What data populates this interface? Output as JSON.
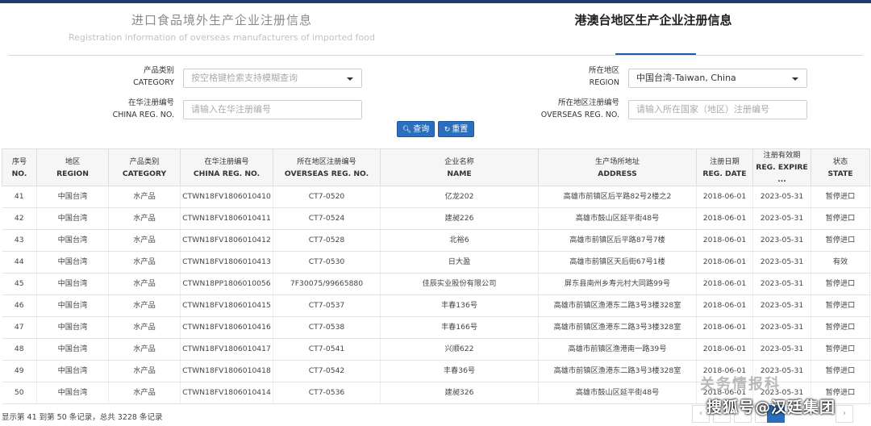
{
  "tabs": {
    "imported_cn": "进口食品境外生产企业注册信息",
    "imported_en": "Registration information of overseas manufacturers of imported food",
    "hk_cn": "港澳台地区生产企业注册信息"
  },
  "filters": {
    "category_cn": "产品类别",
    "category_en": "CATEGORY",
    "category_placeholder": "按空格键检索支持模糊查询",
    "china_reg_cn": "在华注册编号",
    "china_reg_en": "CHINA REG. NO.",
    "china_reg_placeholder": "请输入在华注册编号",
    "region_cn": "所在地区",
    "region_en": "REGION",
    "region_value": "中国台湾-Taiwan, China",
    "overseas_reg_cn": "所在地区注册编号",
    "overseas_reg_en": "OVERSEAS REG. NO.",
    "overseas_reg_placeholder": "请输入所在国家（地区）注册编号"
  },
  "buttons": {
    "query": "查询",
    "reset": "重置"
  },
  "table": {
    "headers": [
      {
        "cn": "序号",
        "en": "NO."
      },
      {
        "cn": "地区",
        "en": "REGION"
      },
      {
        "cn": "产品类别",
        "en": "CATEGORY"
      },
      {
        "cn": "在华注册编号",
        "en": "CHINA REG. NO."
      },
      {
        "cn": "所在地区注册编号",
        "en": "OVERSEAS REG. NO."
      },
      {
        "cn": "企业名称",
        "en": "NAME"
      },
      {
        "cn": "生产场所地址",
        "en": "ADDRESS"
      },
      {
        "cn": "注册日期",
        "en": "REG. DATE"
      },
      {
        "cn": "注册有效期",
        "en": "REG. EXPIRE ..."
      },
      {
        "cn": "状态",
        "en": "STATE"
      }
    ],
    "rows": [
      {
        "no": "41",
        "region": "中国台湾",
        "category": "水产品",
        "china_reg": "CTWN18FV1806010410",
        "overseas_reg": "CT7-0520",
        "name": "亿龙202",
        "address": "高雄市前镇区后平路82号2楼之2",
        "reg_date": "2018-06-01",
        "expire": "2023-05-31",
        "state": "暂停进口"
      },
      {
        "no": "42",
        "region": "中国台湾",
        "category": "水产品",
        "china_reg": "CTWN18FV1806010411",
        "overseas_reg": "CT7-0524",
        "name": "建昶226",
        "address": "高雄市鼓山区延平街48号",
        "reg_date": "2018-06-01",
        "expire": "2023-05-31",
        "state": "暂停进口"
      },
      {
        "no": "43",
        "region": "中国台湾",
        "category": "水产品",
        "china_reg": "CTWN18FV1806010412",
        "overseas_reg": "CT7-0528",
        "name": "北裕6",
        "address": "高雄市前镇区后平路87号7楼",
        "reg_date": "2018-06-01",
        "expire": "2023-05-31",
        "state": "暂停进口"
      },
      {
        "no": "44",
        "region": "中国台湾",
        "category": "水产品",
        "china_reg": "CTWN18FV1806010413",
        "overseas_reg": "CT7-0530",
        "name": "日大盈",
        "address": "高雄市前镇区天后街67号1楼",
        "reg_date": "2018-06-01",
        "expire": "2023-05-31",
        "state": "有效"
      },
      {
        "no": "45",
        "region": "中国台湾",
        "category": "水产品",
        "china_reg": "CTWN18PP1806010056",
        "overseas_reg": "7F30075/99665880",
        "name": "佳辰实业股份有限公司",
        "address": "屏东县南州乡寿元村大同路99号",
        "reg_date": "2018-06-01",
        "expire": "2023-05-31",
        "state": "暂停进口"
      },
      {
        "no": "46",
        "region": "中国台湾",
        "category": "水产品",
        "china_reg": "CTWN18FV1806010415",
        "overseas_reg": "CT7-0537",
        "name": "丰春136号",
        "address": "高雄市前镇区渔港东二路3号3楼328室",
        "reg_date": "2018-06-01",
        "expire": "2023-05-31",
        "state": "暂停进口"
      },
      {
        "no": "47",
        "region": "中国台湾",
        "category": "水产品",
        "china_reg": "CTWN18FV1806010416",
        "overseas_reg": "CT7-0538",
        "name": "丰春166号",
        "address": "高雄市前镇区渔港东二路3号3楼328室",
        "reg_date": "2018-06-01",
        "expire": "2023-05-31",
        "state": "暂停进口"
      },
      {
        "no": "48",
        "region": "中国台湾",
        "category": "水产品",
        "china_reg": "CTWN18FV1806010417",
        "overseas_reg": "CT7-0541",
        "name": "兴顺622",
        "address": "高雄市前镇区渔港南一路39号",
        "reg_date": "2018-06-01",
        "expire": "2023-05-31",
        "state": "暂停进口"
      },
      {
        "no": "49",
        "region": "中国台湾",
        "category": "水产品",
        "china_reg": "CTWN18FV1806010418",
        "overseas_reg": "CT7-0542",
        "name": "丰春36号",
        "address": "高雄市前镇区渔港东二路3号3楼328室",
        "reg_date": "2018-06-01",
        "expire": "2023-05-31",
        "state": "暂停进口"
      },
      {
        "no": "50",
        "region": "中国台湾",
        "category": "水产品",
        "china_reg": "CTWN18FV1806010414",
        "overseas_reg": "CT7-0536",
        "name": "建昶326",
        "address": "高雄市鼓山区延平街48号",
        "reg_date": "2018-06-01",
        "expire": "2023-05-31",
        "state": "暂停进口"
      }
    ]
  },
  "footer": {
    "summary": "显示第 41 到第 50 条记录，总共 3228 条记录"
  },
  "pager": {
    "prev": "‹",
    "next": "›"
  },
  "watermark": {
    "line1": "关务情报科",
    "line2": "搜狐号@汉廷集团"
  }
}
